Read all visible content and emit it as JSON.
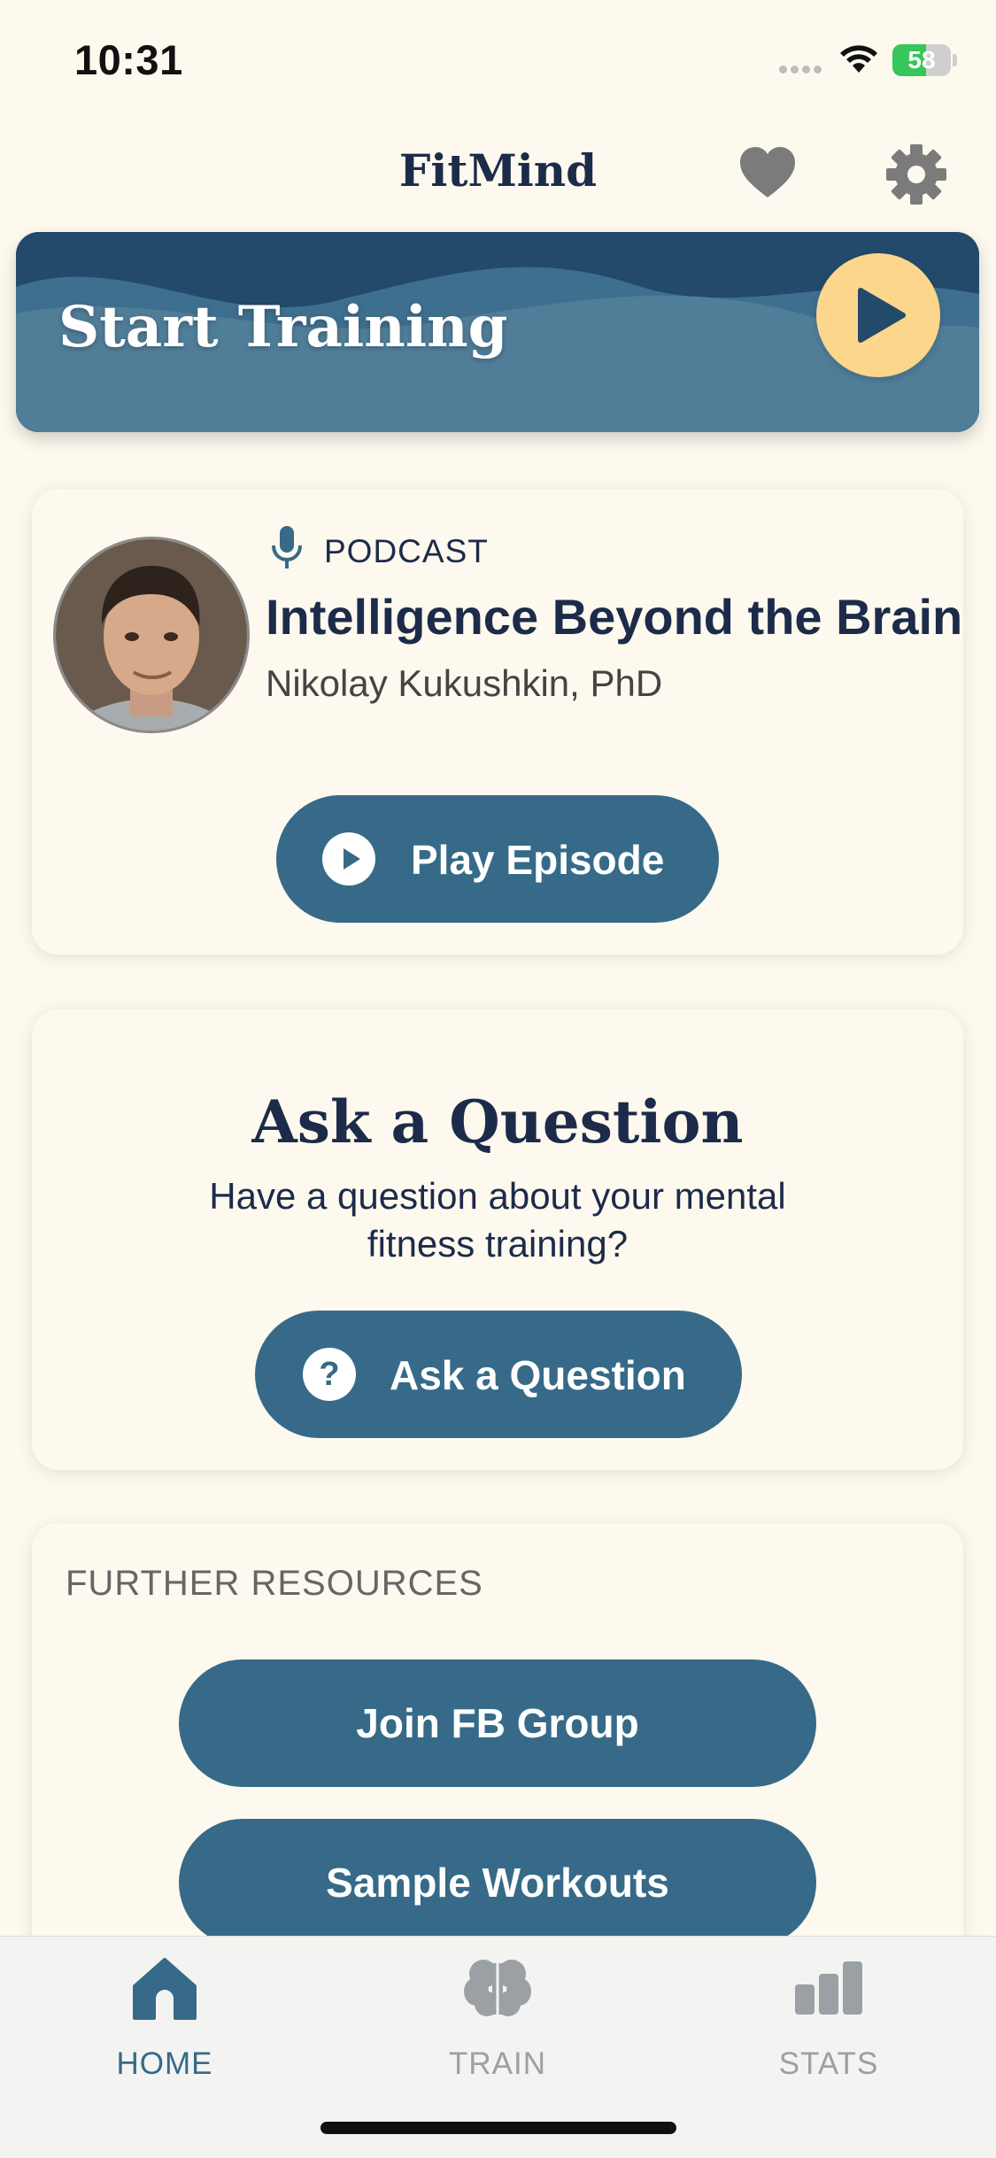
{
  "status_bar": {
    "time": "10:31",
    "battery": "58",
    "battery_level": 0.58
  },
  "header": {
    "title": "FitMind",
    "favorite_icon": "heart-icon",
    "settings_icon": "gear-icon"
  },
  "banner": {
    "title": "Start Training",
    "play_icon": "play-icon"
  },
  "podcast": {
    "label": "PODCAST",
    "title": "Intelligence Beyond the Brain",
    "author": "Nikolay Kukushkin, PhD",
    "play_label": "Play Episode"
  },
  "ask": {
    "title": "Ask a Question",
    "subtitle": "Have a question about your mental fitness training?",
    "button_label": "Ask a Question",
    "button_icon_text": "?"
  },
  "resources": {
    "label": "FURTHER RESOURCES",
    "buttons": [
      "Join FB Group",
      "Sample Workouts"
    ]
  },
  "tabs": [
    {
      "label": "HOME",
      "icon": "home-icon",
      "active": true
    },
    {
      "label": "TRAIN",
      "icon": "brain-icon",
      "active": false
    },
    {
      "label": "STATS",
      "icon": "bar-chart-icon",
      "active": false
    }
  ],
  "colors": {
    "background": "#fdf9ee",
    "primary": "#366a88",
    "navy": "#1d2b4a",
    "accent": "#fcd68c",
    "inactive": "#9aa0a4"
  }
}
